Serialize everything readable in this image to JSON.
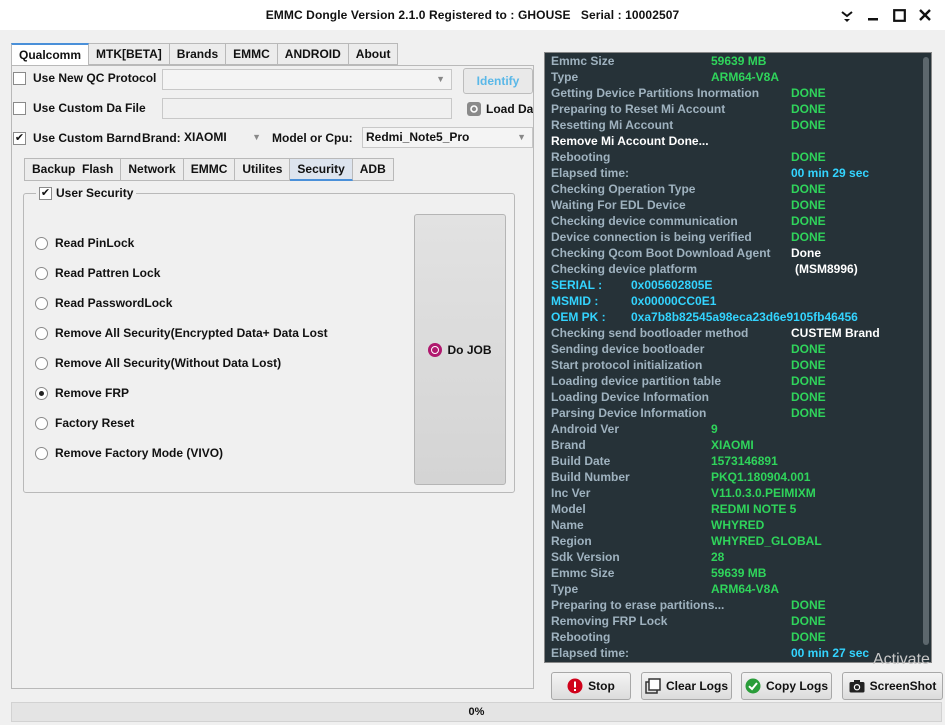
{
  "window": {
    "title": "EMMC Dongle Version 2.1.0 Registered to : GHOUSE   Serial : 10002507"
  },
  "main_tabs": [
    {
      "label": "Qualcomm"
    },
    {
      "label": "MTK[BETA]"
    },
    {
      "label": "Brands"
    },
    {
      "label": "EMMC"
    },
    {
      "label": "ANDROID"
    },
    {
      "label": "About"
    }
  ],
  "options": {
    "use_new_qc_protocol": {
      "label": "Use New QC Protocol",
      "checked": false
    },
    "use_custom_da_file": {
      "label": "Use Custom Da File",
      "checked": false
    },
    "use_custom_brand": {
      "label": "Use Custom Barnd",
      "checked": true
    },
    "brand_label": "Brand:",
    "brand_value": "XIAOMI",
    "model_label": "Model or Cpu:",
    "model_value": "Redmi_Note5_Pro",
    "identify_button": "Identify",
    "load_da_button": "Load Da"
  },
  "sub_tabs": [
    {
      "label": "Backup  Flash"
    },
    {
      "label": "Network"
    },
    {
      "label": "EMMC"
    },
    {
      "label": "Utilites"
    },
    {
      "label": "Security"
    },
    {
      "label": "ADB"
    }
  ],
  "security": {
    "group_label": "User Security",
    "group_checked": true,
    "options": [
      {
        "label": "Read PinLock",
        "selected": false
      },
      {
        "label": "Read Pattren Lock",
        "selected": false
      },
      {
        "label": "Read PasswordLock",
        "selected": false
      },
      {
        "label": "Remove All Security(Encrypted Data+ Data Lost",
        "selected": false
      },
      {
        "label": "Remove All Security(Without Data Lost)",
        "selected": false
      },
      {
        "label": "Remove FRP",
        "selected": true
      },
      {
        "label": "Factory Reset",
        "selected": false
      },
      {
        "label": "Remove Factory Mode (VIVO)",
        "selected": false
      }
    ],
    "do_job_label": "Do JOB"
  },
  "log": [
    {
      "k": "Emmc Size",
      "v": "59639 MB",
      "kc": "lbl",
      "vc": "green",
      "col": "a"
    },
    {
      "k": "Type",
      "v": "ARM64-V8A",
      "kc": "lbl",
      "vc": "green",
      "col": "a"
    },
    {
      "k": "Getting Device Partitions Inormation",
      "v": "DONE",
      "kc": "lbl",
      "vc": "green",
      "col": "b"
    },
    {
      "k": "Preparing to Reset Mi Account",
      "v": "DONE",
      "kc": "lbl",
      "vc": "green",
      "col": "b"
    },
    {
      "k": "Resetting Mi Account",
      "v": "DONE",
      "kc": "lbl",
      "vc": "green",
      "col": "b"
    },
    {
      "k": "Remove Mi Account Done...",
      "v": "",
      "kc": "white",
      "vc": "white",
      "col": "b"
    },
    {
      "k": "Rebooting",
      "v": "DONE",
      "kc": "lbl",
      "vc": "green",
      "col": "b"
    },
    {
      "k": "Elapsed time:",
      "v": "00 min  29 sec",
      "kc": "lbl",
      "vc": "cyan",
      "col": "b"
    },
    {
      "k": "Checking Operation Type",
      "v": "DONE",
      "kc": "lbl",
      "vc": "green",
      "col": "b"
    },
    {
      "k": "Waiting For EDL Device",
      "v": "DONE",
      "kc": "lbl",
      "vc": "green",
      "col": "b"
    },
    {
      "k": "Checking device communication",
      "v": "DONE",
      "kc": "lbl",
      "vc": "green",
      "col": "b"
    },
    {
      "k": "Device connection is being verified",
      "v": "DONE",
      "kc": "lbl",
      "vc": "green",
      "col": "b"
    },
    {
      "k": "Checking Qcom Boot Download Agent",
      "v": "Done",
      "kc": "lbl",
      "vc": "white",
      "col": "b"
    },
    {
      "k": "Checking device platform",
      "v": "(MSM8996)",
      "kc": "lbl",
      "vc": "white",
      "col": "c"
    },
    {
      "k": "SERIAL :",
      "v": "0x005602805E",
      "kc": "cyan",
      "vc": "cyan",
      "col": "s"
    },
    {
      "k": "MSMID  :",
      "v": "0x00000CC0E1",
      "kc": "cyan",
      "vc": "cyan",
      "col": "s"
    },
    {
      "k": "OEM PK :",
      "v": "0xa7b8b82545a98eca23d6e9105fb46456",
      "kc": "cyan",
      "vc": "cyan",
      "col": "s"
    },
    {
      "k": "Checking send bootloader method",
      "v": "CUSTEM Brand",
      "kc": "lbl",
      "vc": "white",
      "col": "b"
    },
    {
      "k": "Sending device bootloader",
      "v": "DONE",
      "kc": "lbl",
      "vc": "green",
      "col": "b"
    },
    {
      "k": "Start protocol initialization",
      "v": "DONE",
      "kc": "lbl",
      "vc": "green",
      "col": "b"
    },
    {
      "k": "Loading device partition table",
      "v": "DONE",
      "kc": "lbl",
      "vc": "green",
      "col": "b"
    },
    {
      "k": "Loading Device Information",
      "v": "DONE",
      "kc": "lbl",
      "vc": "green",
      "col": "b"
    },
    {
      "k": "Parsing Device Information",
      "v": "DONE",
      "kc": "lbl",
      "vc": "green",
      "col": "b"
    },
    {
      "k": "Android Ver",
      "v": "9",
      "kc": "lbl",
      "vc": "green",
      "col": "a"
    },
    {
      "k": "Brand",
      "v": "XIAOMI",
      "kc": "lbl",
      "vc": "green",
      "col": "a"
    },
    {
      "k": "Build Date",
      "v": "1573146891",
      "kc": "lbl",
      "vc": "green",
      "col": "a"
    },
    {
      "k": "Build Number",
      "v": "PKQ1.180904.001",
      "kc": "lbl",
      "vc": "green",
      "col": "a"
    },
    {
      "k": "Inc Ver",
      "v": "V11.0.3.0.PEIMIXM",
      "kc": "lbl",
      "vc": "green",
      "col": "a"
    },
    {
      "k": "Model",
      "v": "REDMI NOTE 5",
      "kc": "lbl",
      "vc": "green",
      "col": "a"
    },
    {
      "k": "Name",
      "v": "WHYRED",
      "kc": "lbl",
      "vc": "green",
      "col": "a"
    },
    {
      "k": "Region",
      "v": "WHYRED_GLOBAL",
      "kc": "lbl",
      "vc": "green",
      "col": "a"
    },
    {
      "k": "Sdk Version",
      "v": "28",
      "kc": "lbl",
      "vc": "green",
      "col": "a"
    },
    {
      "k": "Emmc Size",
      "v": "59639 MB",
      "kc": "lbl",
      "vc": "green",
      "col": "a"
    },
    {
      "k": "Type",
      "v": "ARM64-V8A",
      "kc": "lbl",
      "vc": "green",
      "col": "a"
    },
    {
      "k": "Preparing to erase partitions...",
      "v": "DONE",
      "kc": "lbl",
      "vc": "green",
      "col": "b"
    },
    {
      "k": "Removing FRP Lock",
      "v": "DONE",
      "kc": "lbl",
      "vc": "green",
      "col": "b"
    },
    {
      "k": "Rebooting",
      "v": "DONE",
      "kc": "lbl",
      "vc": "green",
      "col": "b"
    },
    {
      "k": "Elapsed time:",
      "v": "00 min  27 sec",
      "kc": "lbl",
      "vc": "cyan",
      "col": "b"
    }
  ],
  "bottom_buttons": {
    "stop": "Stop",
    "clear_logs": "Clear Logs",
    "copy_logs": "Copy Logs",
    "screenshot": "ScreenShot"
  },
  "watermark": "Activate",
  "progress": {
    "text": "0%",
    "value": 0
  },
  "colors": {
    "log_bg": "#263238",
    "done_green": "#2fd45b",
    "time_cyan": "#33d4ff",
    "stop_red": "#d0021b",
    "copy_green": "#2a9d3a",
    "tab_accent": "#4a90d9"
  }
}
